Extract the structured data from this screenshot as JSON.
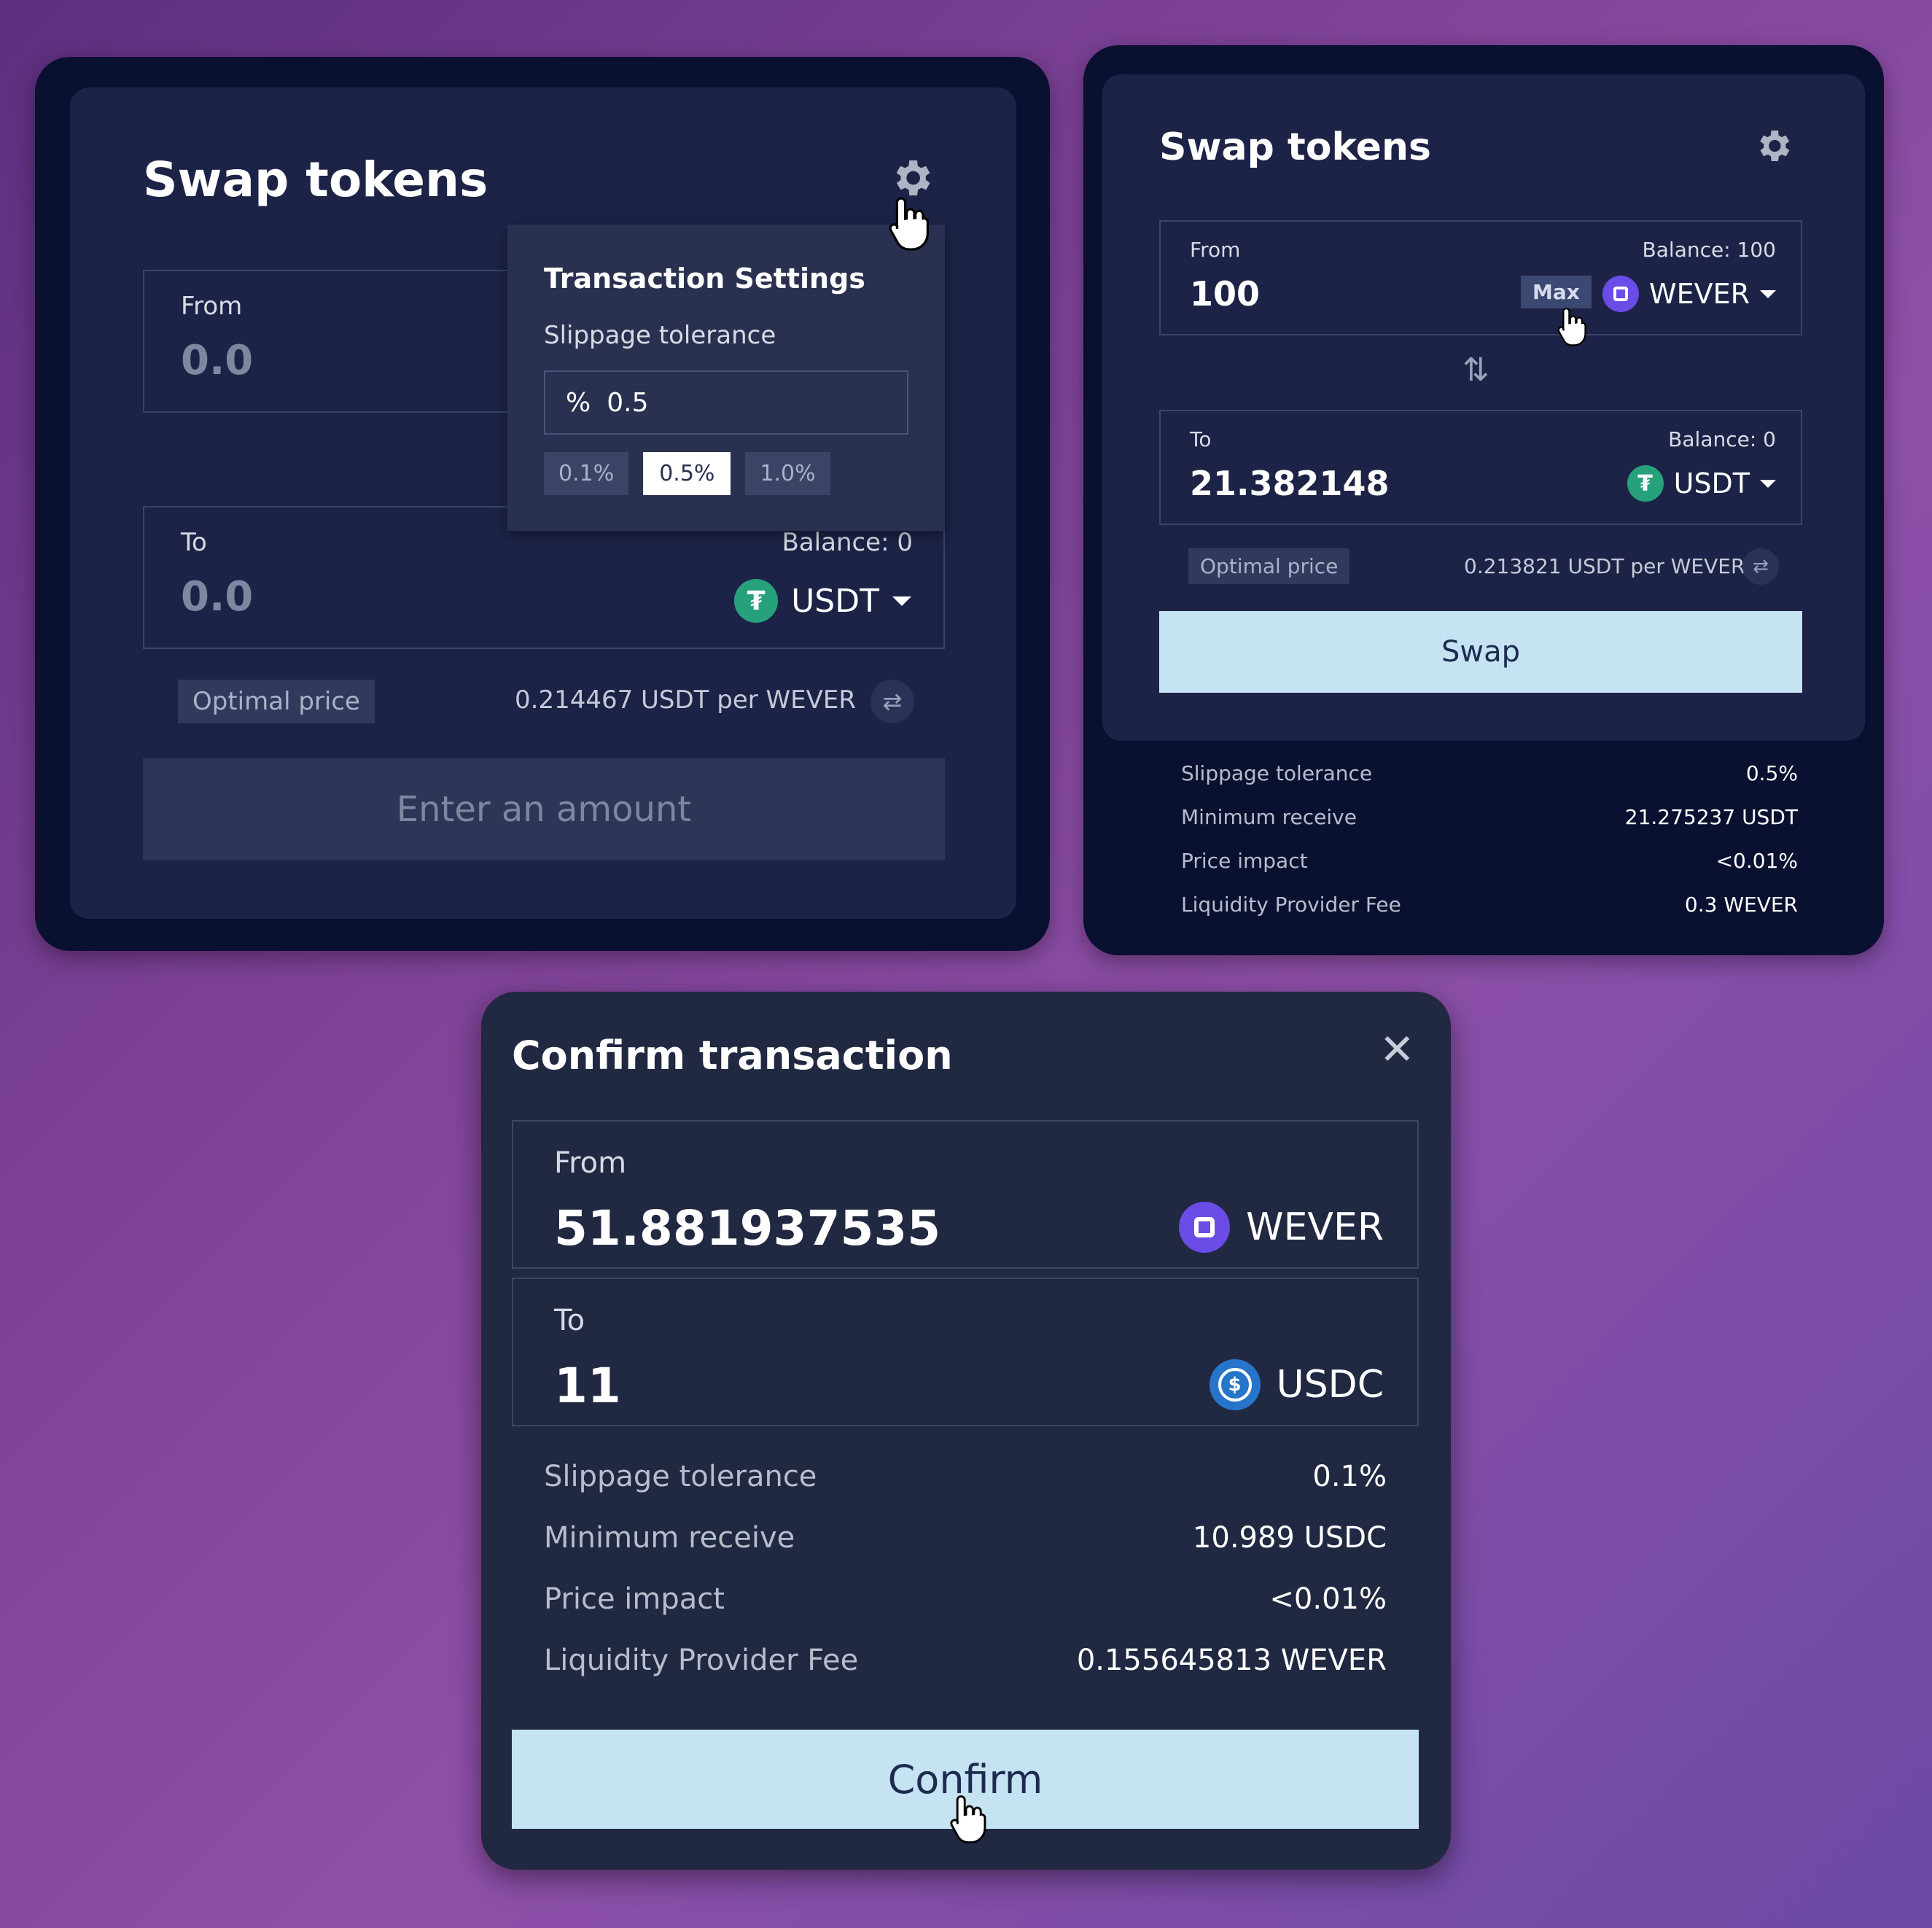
{
  "left_panel": {
    "title": "Swap tokens",
    "from": {
      "label": "From",
      "amount_placeholder": "0.0"
    },
    "settings_popup": {
      "title": "Transaction Settings",
      "slippage_label": "Slippage tolerance",
      "percent_symbol": "%",
      "slippage_value": "0.5",
      "presets": [
        "0.1%",
        "0.5%",
        "1.0%"
      ],
      "selected_preset": "0.5%"
    },
    "to": {
      "label": "To",
      "amount_placeholder": "0.0",
      "balance": "Balance: 0",
      "token": "USDT"
    },
    "optimal_price_label": "Optimal price",
    "price_text": "0.214467 USDT per WEVER",
    "action_button": "Enter an amount"
  },
  "right_panel": {
    "title": "Swap tokens",
    "from": {
      "label": "From",
      "balance": "Balance: 100",
      "amount": "100",
      "max_label": "Max",
      "token": "WEVER"
    },
    "to": {
      "label": "To",
      "balance": "Balance: 0",
      "amount": "21.382148",
      "token": "USDT"
    },
    "optimal_price_label": "Optimal price",
    "price_text": "0.213821 USDT per WEVER",
    "swap_button": "Swap",
    "details": [
      {
        "label": "Slippage tolerance",
        "value": "0.5%"
      },
      {
        "label": "Minimum receive",
        "value": "21.275237 USDT"
      },
      {
        "label": "Price impact",
        "value": "<0.01%"
      },
      {
        "label": "Liquidity Provider Fee",
        "value": "0.3 WEVER"
      }
    ]
  },
  "confirm_modal": {
    "title": "Confirm transaction",
    "from": {
      "label": "From",
      "amount": "51.881937535",
      "token": "WEVER"
    },
    "to": {
      "label": "To",
      "amount": "11",
      "token": "USDC"
    },
    "details": [
      {
        "label": "Slippage tolerance",
        "value": "0.1%"
      },
      {
        "label": "Minimum receive",
        "value": "10.989 USDC"
      },
      {
        "label": "Price impact",
        "value": "<0.01%"
      },
      {
        "label": "Liquidity Provider Fee",
        "value": "0.155645813 WEVER"
      }
    ],
    "confirm_button": "Confirm"
  },
  "colors": {
    "usdt": "#26a17b",
    "wever": "#6b4ce6",
    "usdc": "#2775ca",
    "button_primary": "#c5e3f3",
    "button_disabled": "#2c3657"
  },
  "icons": [
    "gear-icon",
    "cursor-hand-icon",
    "usdt-icon",
    "wever-icon",
    "usdc-icon",
    "swap-direction-icon",
    "refresh-icon",
    "close-icon",
    "caret-down-icon"
  ]
}
